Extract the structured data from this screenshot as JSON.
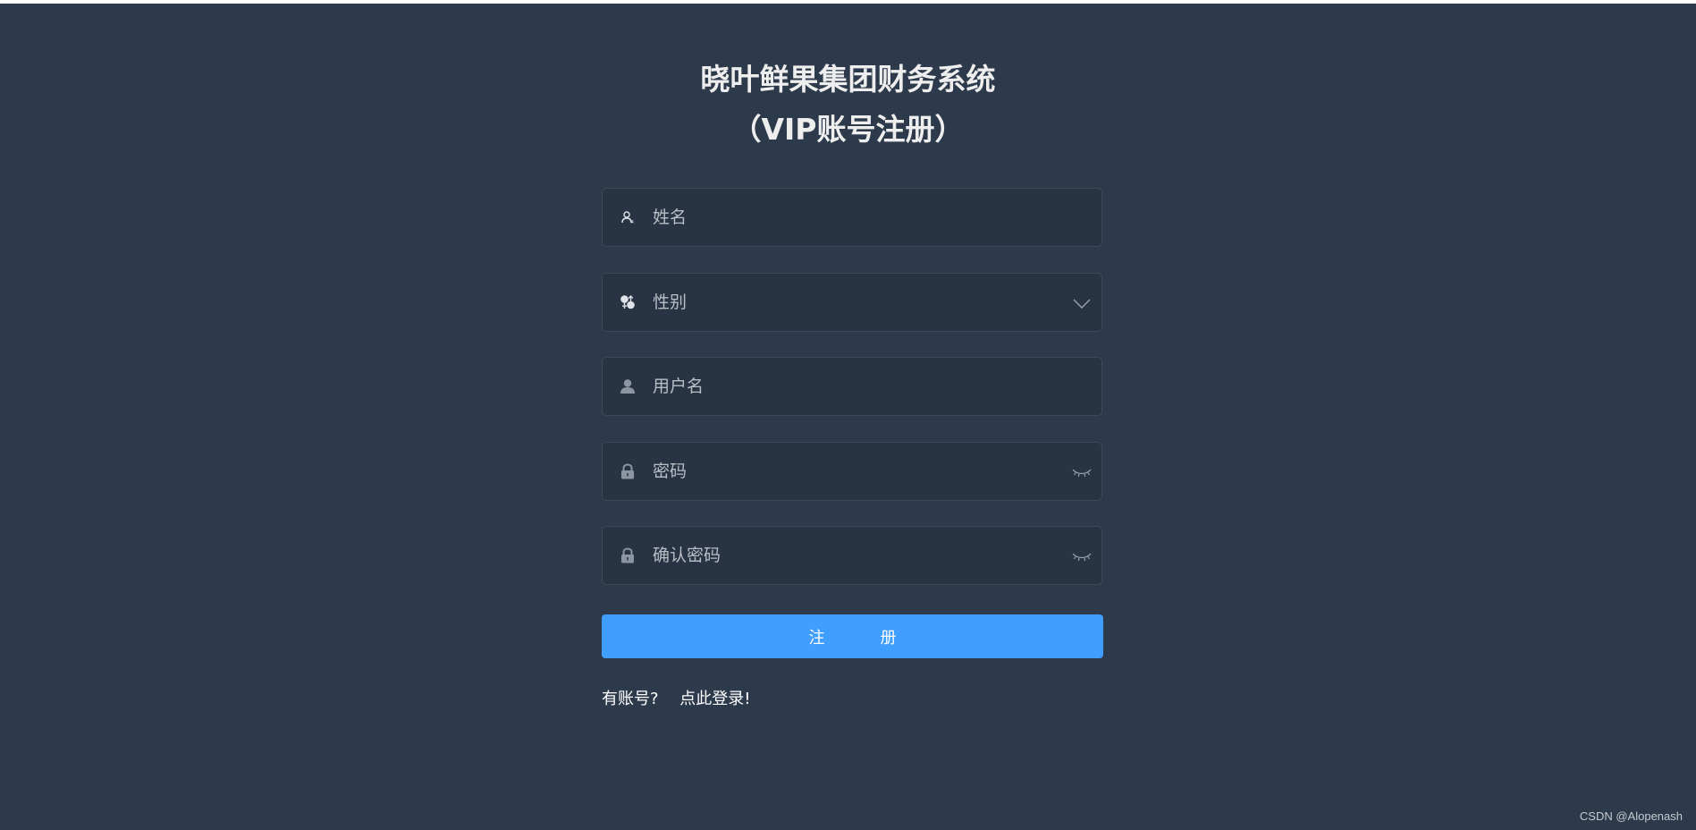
{
  "title": {
    "line1": "晓叶鲜果集团财务系统",
    "line2": "（VIP账号注册）"
  },
  "form": {
    "name_placeholder": "姓名",
    "gender_placeholder": "性别",
    "username_placeholder": "用户名",
    "password_placeholder": "密码",
    "confirm_password_placeholder": "确认密码"
  },
  "register_button": {
    "char1": "注",
    "char2": "册"
  },
  "login_prompt": {
    "question": "有账号?",
    "link": "点此登录!"
  },
  "watermark": "CSDN @Alopenash",
  "colors": {
    "background": "#2d3a4b",
    "primary": "#409eff",
    "text_light": "#eeeeee",
    "placeholder": "#b8bec6"
  },
  "icons": {
    "name": "user-outline-icon",
    "gender": "gender-icon",
    "username": "user-filled-icon",
    "password": "lock-icon",
    "confirm_password": "lock-icon",
    "select_arrow": "chevron-down-icon",
    "password_toggle": "eye-closed-icon"
  }
}
